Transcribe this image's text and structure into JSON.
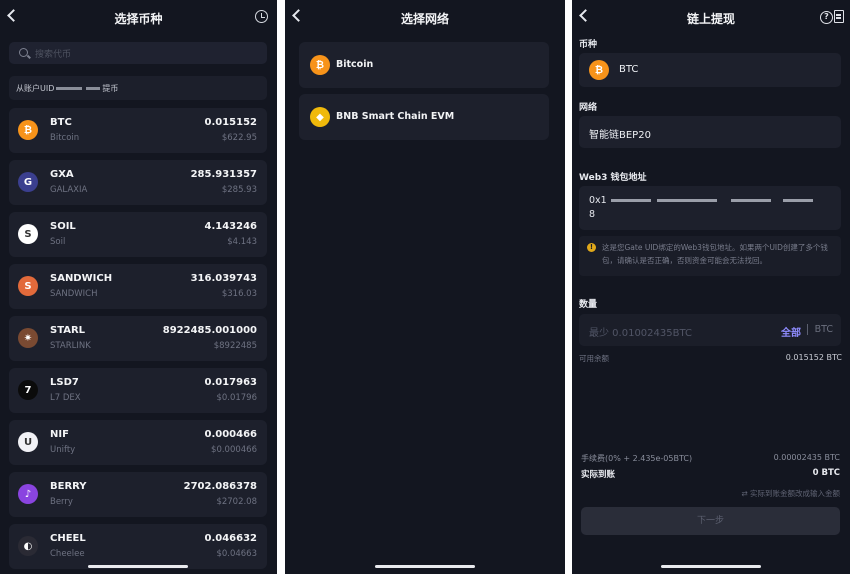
{
  "panel1": {
    "title": "选择币种",
    "search_placeholder": "搜索代币",
    "from_prefix": "从账户UID",
    "from_suffix": "提币",
    "coins": [
      {
        "symbol": "BTC",
        "name": "Bitcoin",
        "amount": "0.015152",
        "usd": "$622.95",
        "icon": "bitcoin-icon",
        "color": "#f7931a",
        "glyph": "₿"
      },
      {
        "symbol": "GXA",
        "name": "GALAXIA",
        "amount": "285.931357",
        "usd": "$285.93",
        "icon": "galaxia-icon",
        "color": "#3b3f8f",
        "glyph": "G"
      },
      {
        "symbol": "SOIL",
        "name": "Soil",
        "amount": "4.143246",
        "usd": "$4.143",
        "icon": "soil-icon",
        "color": "#ffffff",
        "glyph": "S"
      },
      {
        "symbol": "SANDWICH",
        "name": "SANDWICH",
        "amount": "316.039743",
        "usd": "$316.03",
        "icon": "sandwich-icon",
        "color": "#e26a3b",
        "glyph": "S"
      },
      {
        "symbol": "STARL",
        "name": "STARLINK",
        "amount": "8922485.001000",
        "usd": "$8922485",
        "icon": "starlink-icon",
        "color": "#7a4a32",
        "glyph": "✷"
      },
      {
        "symbol": "LSD7",
        "name": "L7 DEX",
        "amount": "0.017963",
        "usd": "$0.01796",
        "icon": "lsd7-icon",
        "color": "#0b0b0b",
        "glyph": "7"
      },
      {
        "symbol": "NIF",
        "name": "Unifty",
        "amount": "0.000466",
        "usd": "$0.000466",
        "icon": "unifty-icon",
        "color": "#f1f1f6",
        "glyph": "U"
      },
      {
        "symbol": "BERRY",
        "name": "Berry",
        "amount": "2702.086378",
        "usd": "$2702.08",
        "icon": "berry-icon",
        "color": "#8a44e0",
        "glyph": "♪"
      },
      {
        "symbol": "CHEEL",
        "name": "Cheelee",
        "amount": "0.046632",
        "usd": "$0.04663",
        "icon": "cheelee-icon",
        "color": "#2a2a34",
        "glyph": "◐"
      }
    ]
  },
  "panel2": {
    "title": "选择网络",
    "networks": [
      {
        "label": "Bitcoin",
        "icon": "bitcoin-icon",
        "color": "#f7931a",
        "glyph": "₿"
      },
      {
        "label": "BNB Smart Chain EVM",
        "icon": "bnb-icon",
        "color": "#f0b90b",
        "glyph": "◆"
      }
    ]
  },
  "panel3": {
    "title": "链上提现",
    "currency_label": "币种",
    "currency_value": "BTC",
    "network_label": "网络",
    "network_value": "智能链BEP20",
    "address_label": "Web3 钱包地址",
    "address_start": "0x1",
    "address_line2": "8",
    "warning": "这是您Gate UID绑定的Web3钱包地址。如果两个UID创建了多个钱包，请确认是否正确，否则资金可能会无法找回。",
    "amount_label": "数量",
    "amount_placeholder": "最少 0.01002435BTC",
    "all_label": "全部",
    "unit": "BTC",
    "available_label": "可用余额",
    "available_value": "0.015152 BTC",
    "fee_label": "手续费(0% + 2.435e-05BTC)",
    "fee_value": "0.00002435 BTC",
    "receive_label": "实际到账",
    "receive_value": "0 BTC",
    "switch_text": "⇄ 实际到账金额改成输入金额",
    "next_button": "下一步"
  }
}
